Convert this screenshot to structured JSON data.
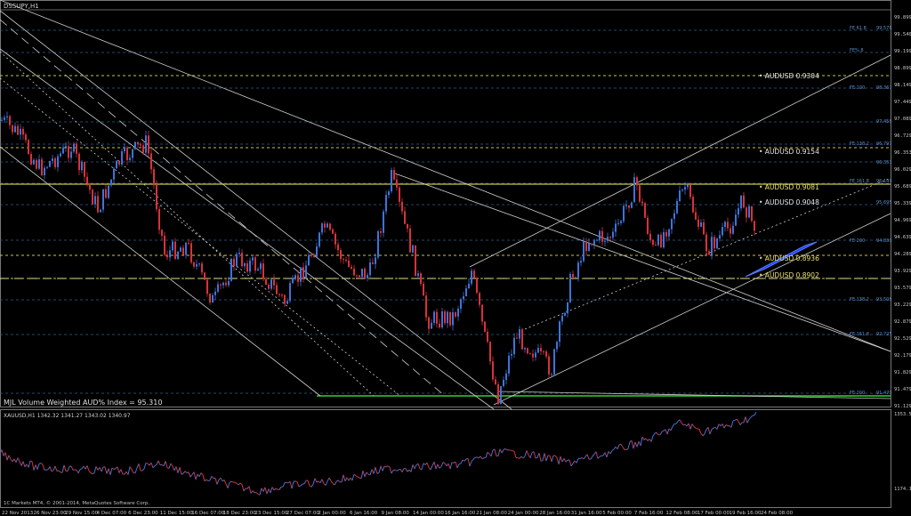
{
  "window": {
    "main_title": "DSSUPY,H1",
    "sub_title": "XAUUSD,H1 1342.32 1341.27 1343.02 1340.97",
    "footer_text": "1C Markets MT4, © 2001-2014, MetaQuotes Software Corp.",
    "index_label": "MJL Volume Weighted AUD% Index = 95.310"
  },
  "colors": {
    "background": "#000000",
    "candle_up": "#3d74d8",
    "candle_down": "#d8323a",
    "price_level": "#c9c34a",
    "fib_level": "#2e5f95",
    "trendline": "#cfcfcf",
    "support_line": "#2fd42f",
    "projection": "#1d3cff"
  },
  "price_axis": [
    "99.899",
    "99.540",
    "99.199",
    "98.899",
    "98.149",
    "97.449",
    "97.089",
    "96.729",
    "96.353",
    "96.029",
    "95.689",
    "95.339",
    "94.969",
    "94.639",
    "94.289",
    "93.929",
    "93.579",
    "93.229",
    "92.879",
    "92.529",
    "92.179",
    "91.829",
    "91.479",
    "91.129"
  ],
  "sub_axis": [
    "1353.53",
    "1174.11"
  ],
  "time_axis": [
    "22 Nov 2013",
    "26 Nov 23:00",
    "29 Nov 15:00",
    "4 Dec 07:00",
    "6 Dec 23:00",
    "11 Dec 15:00",
    "16 Dec 07:00",
    "18 Dec 23:00",
    "23 Dec 15:00",
    "27 Dec 07:00",
    "2 Jan 00:00",
    "6 Jan 16:00",
    "9 Jan 08:00",
    "14 Jan 00:00",
    "16 Jan 16:00",
    "21 Jan 08:00",
    "24 Jan 00:00",
    "28 Jan 16:00",
    "31 Jan 16:00",
    "5 Feb 00:00",
    "7 Feb 16:00",
    "12 Feb 08:00",
    "17 Feb 00:00",
    "19 Feb 16:00",
    "24 Feb 08:00"
  ],
  "audusd_levels": [
    {
      "label": "AUDUSD",
      "value": "0.9304"
    },
    {
      "label": "AUDUSD",
      "value": "0.9154"
    },
    {
      "label": "AUDUSD",
      "value": "0.9081"
    },
    {
      "label": "AUDUSD",
      "value": "0.9048"
    },
    {
      "label": "AUDUSD",
      "value": "0.8936"
    },
    {
      "label": "AUDUSD",
      "value": "0.8902"
    }
  ],
  "fib_labels": [
    {
      "label": "FE 61.8",
      "value": "99.576"
    },
    {
      "label": "FE%.8",
      "value": ""
    },
    {
      "label": "FE 100",
      "value": "98.367"
    },
    {
      "label": "",
      "value": "97.458"
    },
    {
      "label": "FE 138.2",
      "value": "96.797"
    },
    {
      "label": "",
      "value": "96.353"
    },
    {
      "label": "FE 161.8",
      "value": "96.149"
    },
    {
      "label": "",
      "value": "95.695"
    },
    {
      "label": "FE 200",
      "value": "94.830"
    },
    {
      "label": "FE 138.2",
      "value": "93.508"
    },
    {
      "label": "FE 161.8",
      "value": "92.725"
    },
    {
      "label": "FE 200",
      "value": "91.470"
    }
  ]
}
